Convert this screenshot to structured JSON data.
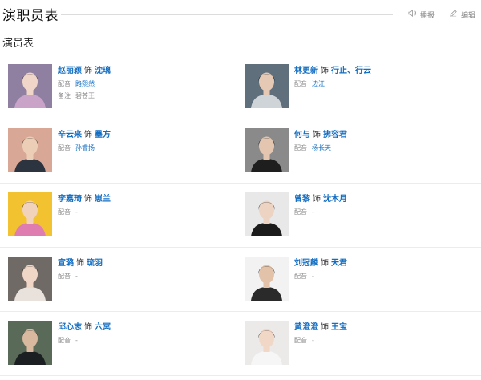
{
  "header": {
    "title": "演职员表",
    "broadcast_label": "播报",
    "edit_label": "编辑"
  },
  "section": {
    "title": "演员表"
  },
  "cast": [
    {
      "actor": "赵丽颖",
      "as": "饰",
      "role": "沈璃",
      "dub_label": "配音",
      "dub_value": "路熙然",
      "dub_is_link": true,
      "note_label": "备注",
      "note_value": "碧苍王",
      "photo": {
        "bg": "#8f7fa0",
        "hair": "#3a2b2b",
        "skin": "#f0d6c8",
        "cloth": "#c9a3c8"
      }
    },
    {
      "actor": "林更新",
      "as": "饰",
      "role": "行止、行云",
      "dub_label": "配音",
      "dub_value": "边江",
      "dub_is_link": true,
      "photo": {
        "bg": "#5f6f7c",
        "hair": "#1a1a1a",
        "skin": "#e6c9b4",
        "cloth": "#cfd4d8"
      }
    },
    {
      "actor": "辛云来",
      "as": "饰",
      "role": "墨方",
      "dub_label": "配音",
      "dub_value": "孙睿扬",
      "dub_is_link": true,
      "photo": {
        "bg": "#d9a796",
        "hair": "#1c1c1c",
        "skin": "#eccdb6",
        "cloth": "#2c3440"
      }
    },
    {
      "actor": "何与",
      "as": "饰",
      "role": "拂容君",
      "dub_label": "配音",
      "dub_value": "杨长天",
      "dub_is_link": true,
      "photo": {
        "bg": "#8a8a8a",
        "hair": "#161616",
        "skin": "#e4c6b0",
        "cloth": "#1e1e1e"
      }
    },
    {
      "actor": "李嘉琦",
      "as": "饰",
      "role": "崽兰",
      "dub_label": "配音",
      "dub_value": "-",
      "dub_is_link": false,
      "photo": {
        "bg": "#f2c230",
        "hair": "#2a1c14",
        "skin": "#f1d2bb",
        "cloth": "#e07db0"
      }
    },
    {
      "actor": "曾黎",
      "as": "饰",
      "role": "沈木月",
      "dub_label": "配音",
      "dub_value": "-",
      "dub_is_link": false,
      "photo": {
        "bg": "#e8e8e8",
        "hair": "#1a1a1a",
        "skin": "#ecd3c2",
        "cloth": "#1b1b1b"
      }
    },
    {
      "actor": "宣璐",
      "as": "饰",
      "role": "琉羽",
      "dub_label": "配音",
      "dub_value": "-",
      "dub_is_link": false,
      "photo": {
        "bg": "#6f6a66",
        "hair": "#211a17",
        "skin": "#efd6c6",
        "cloth": "#e9e2dc"
      }
    },
    {
      "actor": "刘冠麟",
      "as": "饰",
      "role": "天君",
      "dub_label": "配音",
      "dub_value": "-",
      "dub_is_link": false,
      "photo": {
        "bg": "#f2f2f2",
        "hair": "#151515",
        "skin": "#e2c2a8",
        "cloth": "#2a2a2a"
      }
    },
    {
      "actor": "邱心志",
      "as": "饰",
      "role": "六冥",
      "dub_label": "配音",
      "dub_value": "-",
      "dub_is_link": false,
      "photo": {
        "bg": "#5a6a58",
        "hair": "#141414",
        "skin": "#d8b89e",
        "cloth": "#1c1f22"
      }
    },
    {
      "actor": "黄澄澄",
      "as": "饰",
      "role": "王宝",
      "dub_label": "配音",
      "dub_value": "-",
      "dub_is_link": false,
      "photo": {
        "bg": "#eceae8",
        "hair": "#2a1e18",
        "skin": "#f1d7c6",
        "cloth": "#f6f6f6"
      }
    }
  ]
}
